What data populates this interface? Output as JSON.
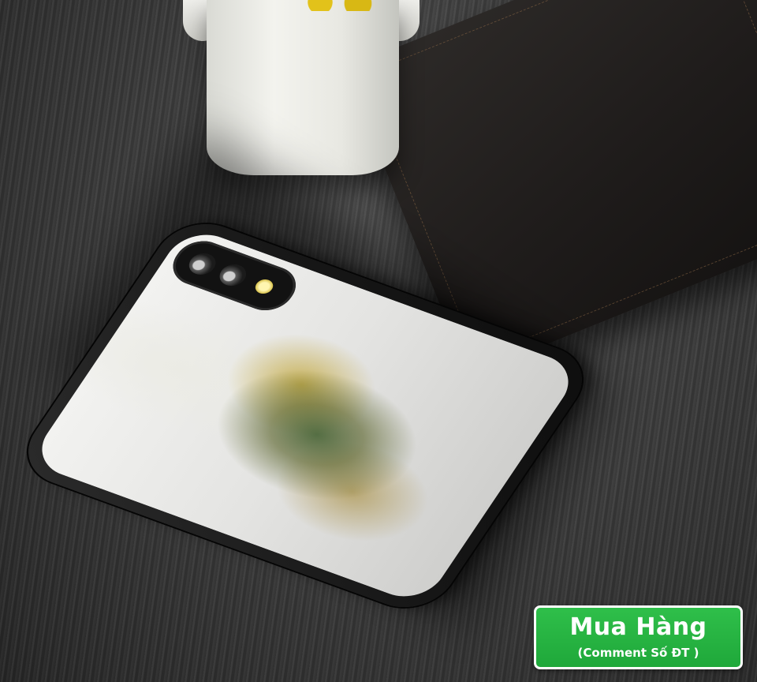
{
  "badge": {
    "title": "Mua Hàng",
    "subtitle": "(Comment Số ĐT )",
    "color": "#1fa83a",
    "border_color": "#ffffff"
  },
  "scene": {
    "phone_icon": "mirror-phone-case",
    "pot_icon": "flower-pot",
    "notebook_icon": "leather-notebook"
  }
}
